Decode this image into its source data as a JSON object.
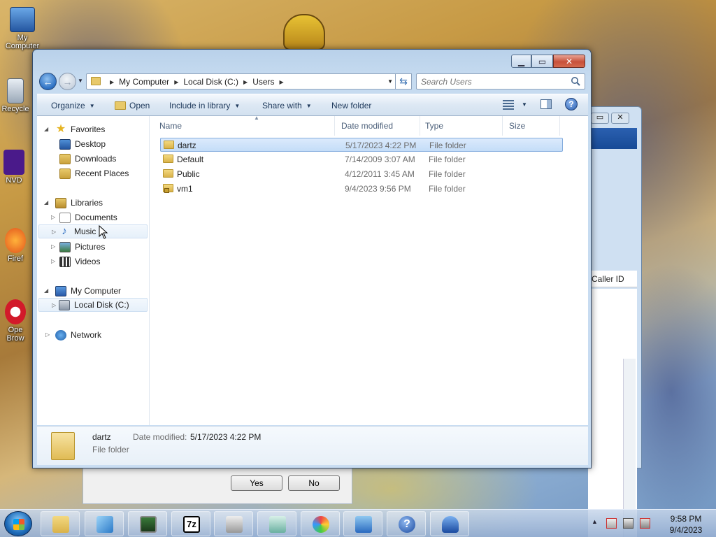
{
  "desktop": {
    "icons": [
      {
        "label": "My Computer"
      },
      {
        "label": "Recycle"
      },
      {
        "label": "NVD"
      },
      {
        "label": "Firef"
      },
      {
        "label": "Ope\nBrow"
      }
    ]
  },
  "explorer": {
    "address": {
      "crumbs": [
        "My Computer",
        "Local Disk (C:)",
        "Users"
      ]
    },
    "search": {
      "placeholder": "Search Users"
    },
    "toolbar": {
      "organize": "Organize",
      "open": "Open",
      "include_in_library": "Include in library",
      "share_with": "Share with",
      "new_folder": "New folder"
    },
    "nav": {
      "favorites": "Favorites",
      "desktop": "Desktop",
      "downloads": "Downloads",
      "recent_places": "Recent Places",
      "libraries": "Libraries",
      "documents": "Documents",
      "music": "Music",
      "pictures": "Pictures",
      "videos": "Videos",
      "my_computer": "My Computer",
      "local_disk": "Local Disk (C:)",
      "network": "Network"
    },
    "columns": {
      "name": "Name",
      "date": "Date modified",
      "type": "Type",
      "size": "Size"
    },
    "files": [
      {
        "name": "dartz",
        "date": "5/17/2023 4:22 PM",
        "type": "File folder",
        "selected": true
      },
      {
        "name": "Default",
        "date": "7/14/2009 3:07 AM",
        "type": "File folder",
        "selected": false
      },
      {
        "name": "Public",
        "date": "4/12/2011 3:45 AM",
        "type": "File folder",
        "selected": false
      },
      {
        "name": "vm1",
        "date": "9/4/2023 9:56 PM",
        "type": "File folder",
        "selected": false
      }
    ],
    "details": {
      "name": "dartz",
      "type": "File folder",
      "date_label": "Date modified:",
      "date_value": "5/17/2023 4:22 PM"
    }
  },
  "background_window": {
    "column_header": "Caller ID"
  },
  "dialog": {
    "yes": "Yes",
    "no": "No"
  },
  "taskbar": {
    "apps": [
      "explorer-icon",
      "send-icon",
      "network-monitor-icon",
      "7zip-icon",
      "fax-icon",
      "document-icon",
      "paint-icon",
      "control-panel-icon",
      "help-icon",
      "ship-icon"
    ],
    "seven_zip_label": "7z",
    "help_label": "?"
  },
  "clock": {
    "time": "9:58 PM",
    "date": "9/4/2023"
  }
}
